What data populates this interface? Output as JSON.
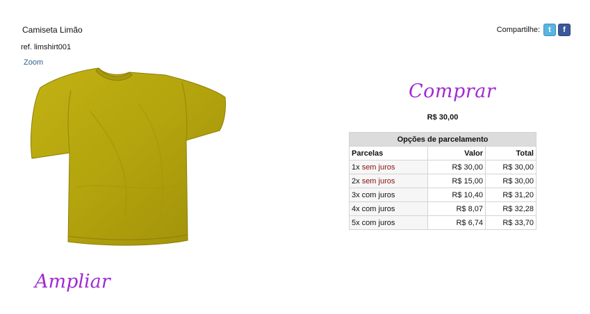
{
  "product": {
    "name": "Camiseta Limão",
    "ref": "ref. limshirt001",
    "zoom_label": "Zoom",
    "image_icon": "yellow-tshirt",
    "shirt_color": "#b8a80f"
  },
  "share": {
    "label": "Compartilhe:",
    "icons": [
      "twitter-icon",
      "facebook-icon"
    ]
  },
  "buy": {
    "label": "Comprar",
    "price": "R$ 30,00",
    "accent": "#a12ad3"
  },
  "installments": {
    "caption": "Opções de parcelamento",
    "headers": [
      "Parcelas",
      "Valor",
      "Total"
    ],
    "rows": [
      {
        "count": "1x",
        "note": "sem juros",
        "value": "R$ 30,00",
        "total": "R$ 30,00"
      },
      {
        "count": "2x",
        "note": "sem juros",
        "value": "R$ 15,00",
        "total": "R$ 30,00"
      },
      {
        "count": "3x com juros",
        "note": "",
        "value": "R$ 10,40",
        "total": "R$ 31,20"
      },
      {
        "count": "4x com juros",
        "note": "",
        "value": "R$ 8,07",
        "total": "R$ 32,28"
      },
      {
        "count": "5x com juros",
        "note": "",
        "value": "R$ 6,74",
        "total": "R$ 33,70"
      }
    ]
  },
  "enlarge_label": "Ampliar"
}
